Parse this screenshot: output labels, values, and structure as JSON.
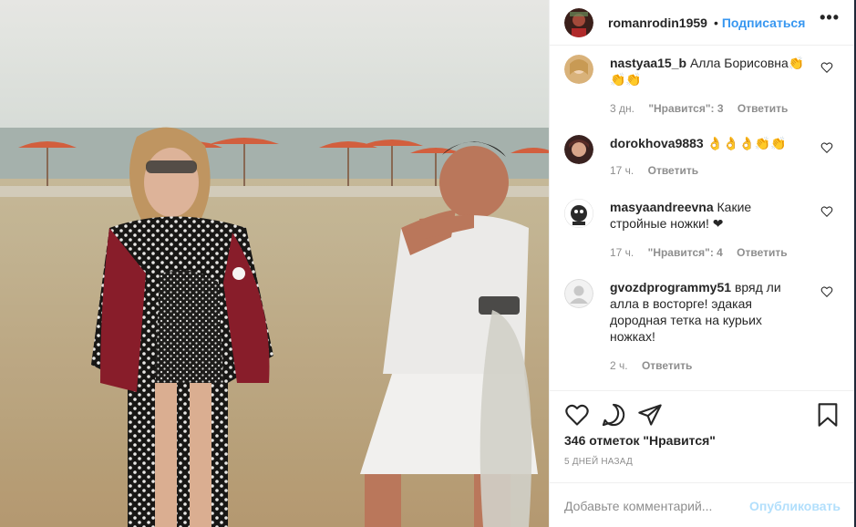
{
  "post": {
    "author": "romanrodin1959",
    "separator": "•",
    "follow_label": "Подписаться",
    "more_label": "•••"
  },
  "comments": [
    {
      "username": "nastyaa15_b",
      "text": "Алла Борисовна👏👏👏",
      "time": "3 дн.",
      "likes": "\"Нравится\": 3",
      "reply": "Ответить"
    },
    {
      "username": "dorokhova9883",
      "text": "👌👌👌👏👏",
      "time": "17 ч.",
      "likes": "",
      "reply": "Ответить"
    },
    {
      "username": "masyaandreevna",
      "text": "Какие стройные ножки! ❤",
      "time": "17 ч.",
      "likes": "\"Нравится\": 4",
      "reply": "Ответить"
    },
    {
      "username": "gvozdprogrammy51",
      "text": "вряд ли алла в восторге! эдакая дородная тетка на курьих ножках!",
      "time": "2 ч.",
      "likes": "",
      "reply": "Ответить"
    }
  ],
  "actions": {
    "likes_text": "346 отметок \"Нравится\"",
    "date_text": "5 ДНЕЙ НАЗАД",
    "comment_placeholder": "Добавьте комментарий...",
    "publish_label": "Опубликовать"
  },
  "colors": {
    "accent": "#3897f0",
    "publish_disabled": "#b2dffc",
    "muted": "#8e8e8e",
    "text": "#262626"
  },
  "icons": [
    "more-icon",
    "heart-icon",
    "comment-icon",
    "share-icon",
    "bookmark-icon"
  ]
}
